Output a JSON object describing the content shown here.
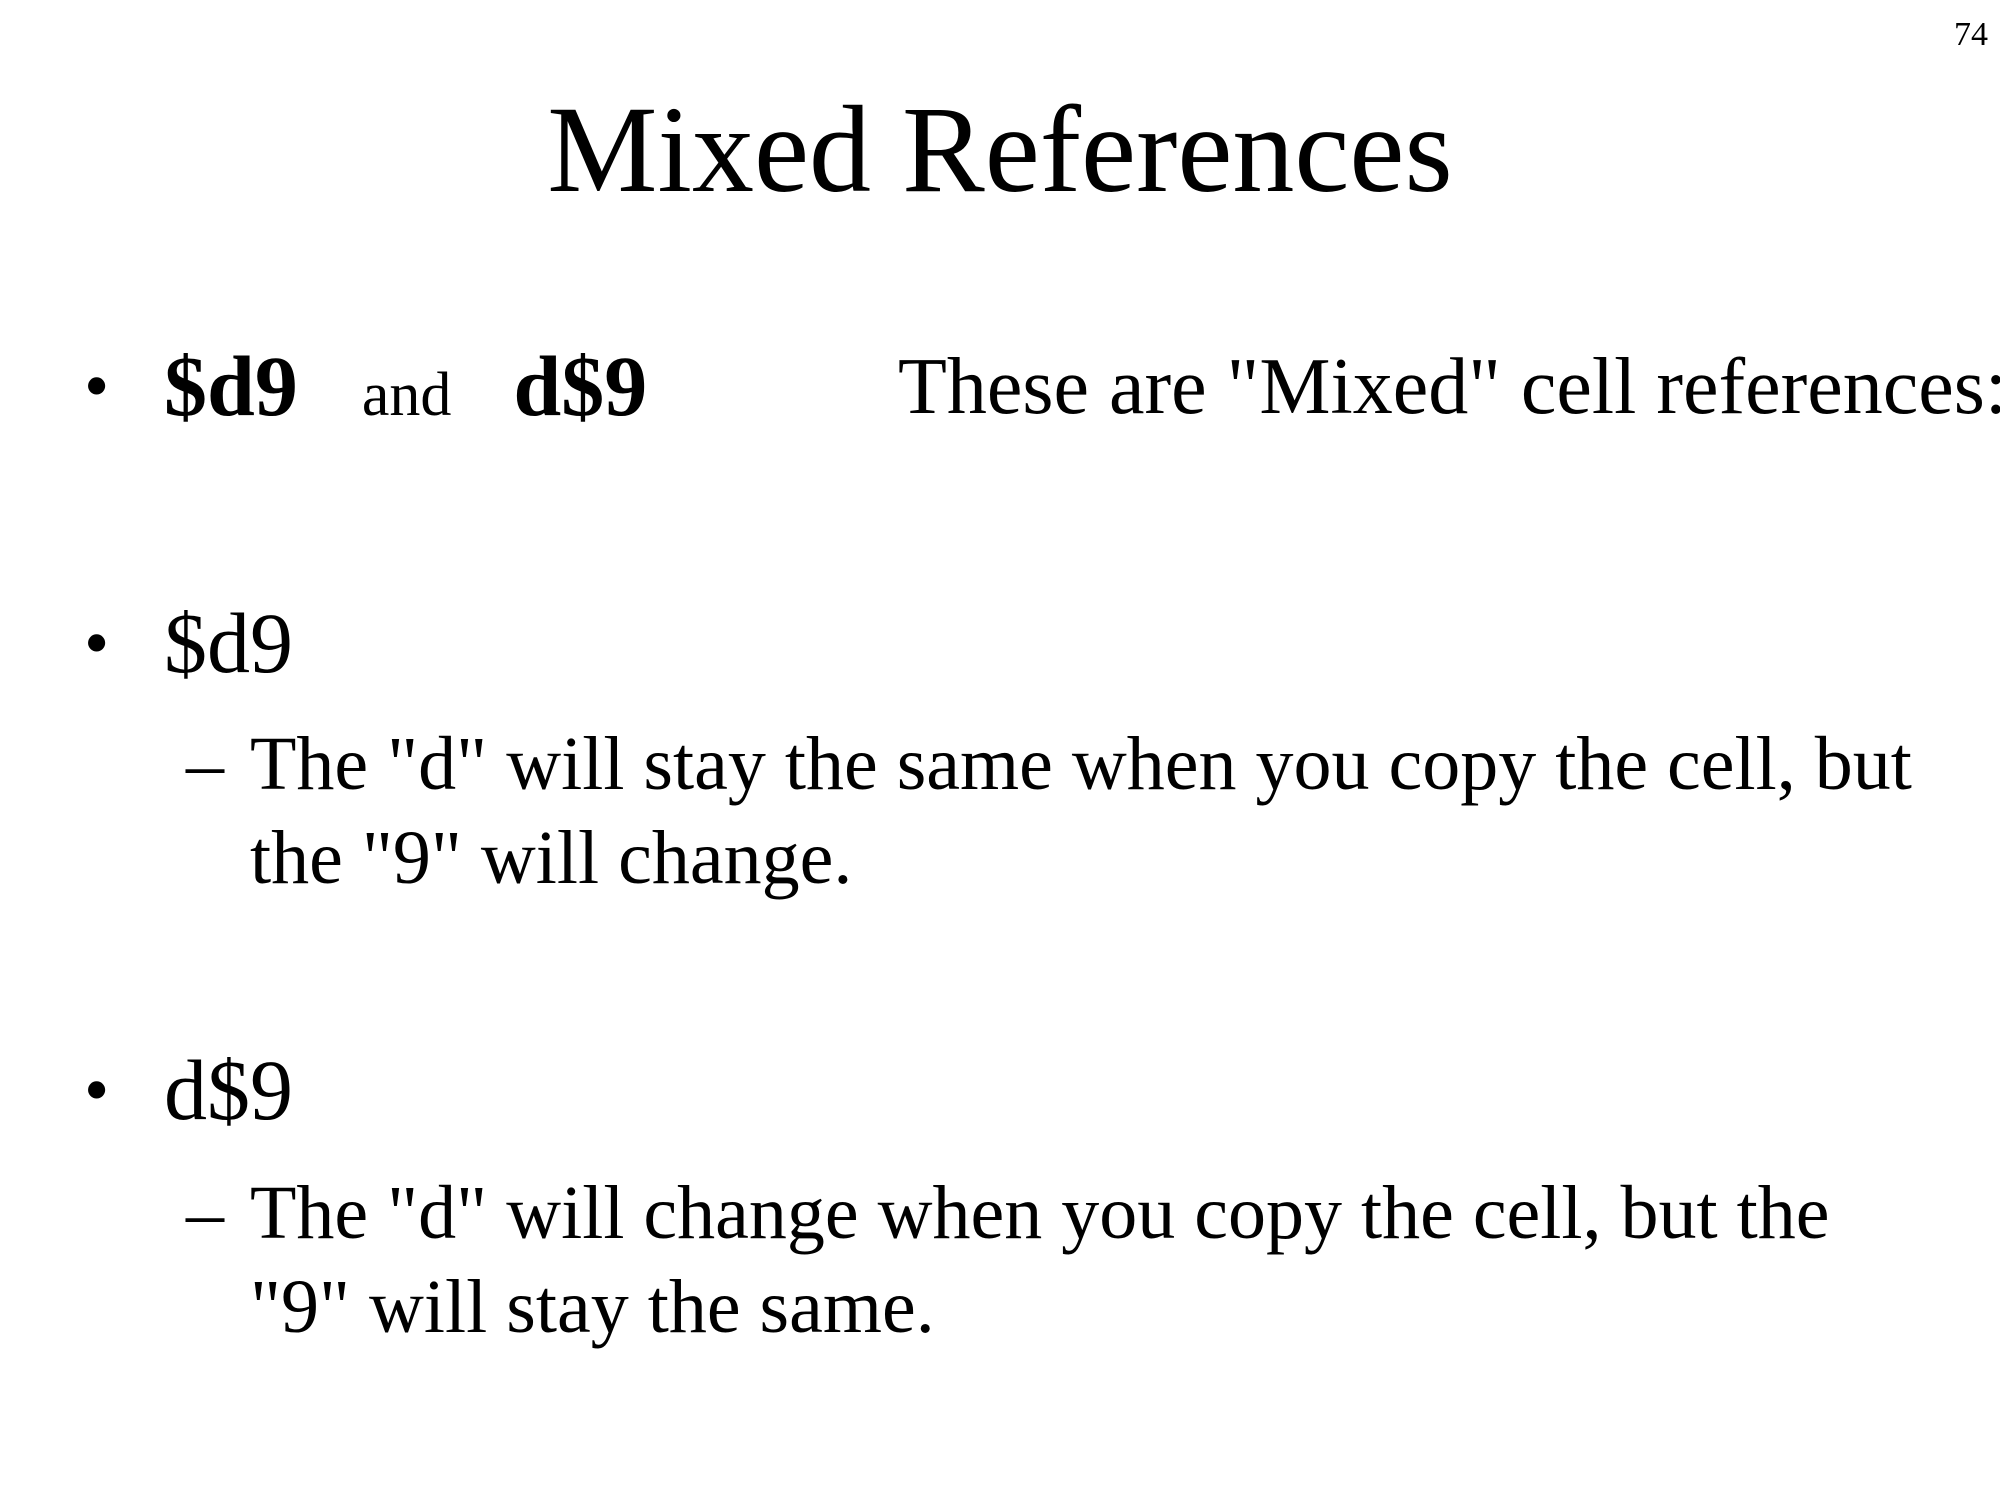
{
  "slide": {
    "page_number": "74",
    "title": "Mixed References",
    "bullet_symbol": "•",
    "sub_bullet_symbol": "–",
    "bullets": [
      {
        "ref1": "$d9",
        "connector": "and",
        "ref2": "d$9",
        "description": "These are \"Mixed\" cell references:"
      },
      {
        "label": "$d9",
        "sub_lines": [
          "The \"d\" will stay the same when you copy the cell, but",
          "the \"9\" will change."
        ]
      },
      {
        "label": "d$9",
        "sub_lines": [
          "The \"d\" will change when you copy the cell, but the",
          "\"9\" will stay the same."
        ]
      }
    ]
  }
}
